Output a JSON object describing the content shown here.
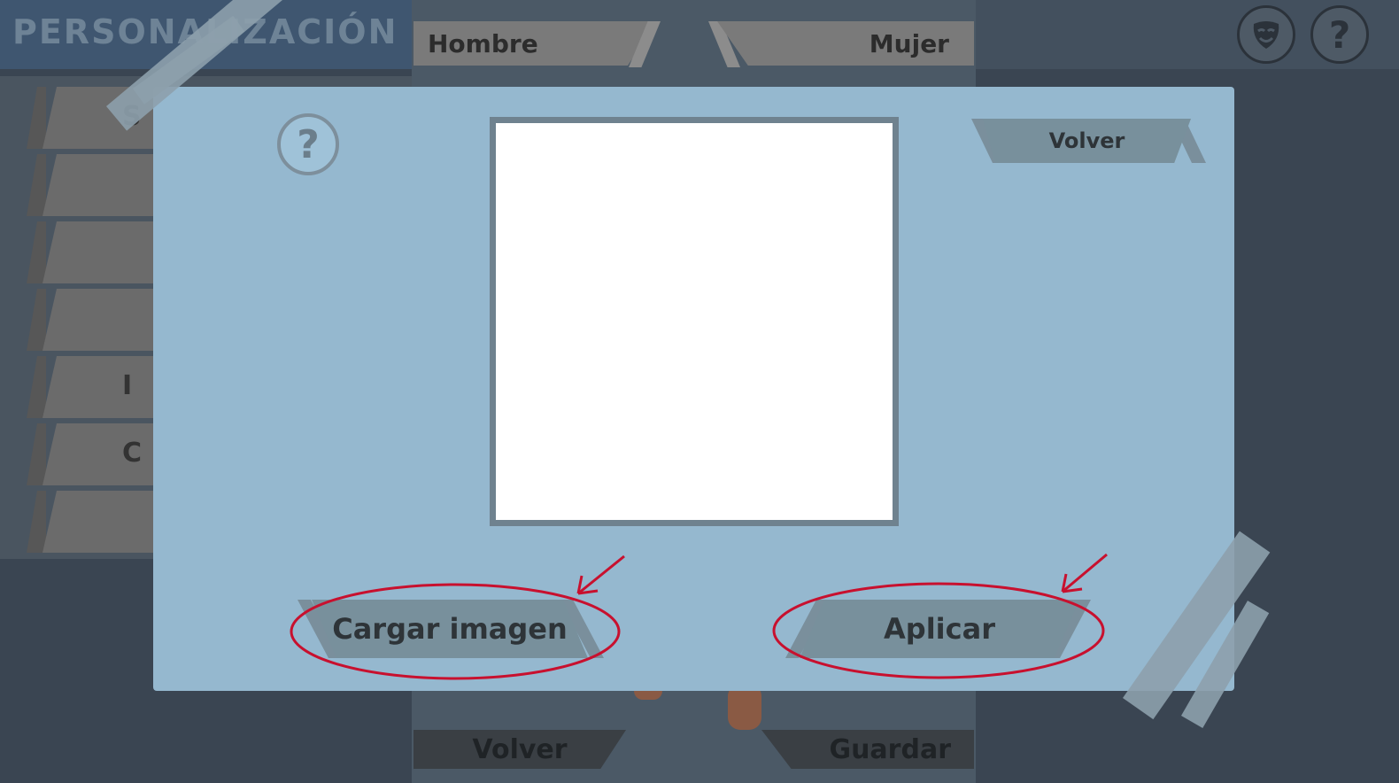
{
  "header": {
    "title": "PERSONALIZACIÓN",
    "tabs": [
      {
        "label": "Hombre"
      },
      {
        "label": "Mujer"
      }
    ],
    "icons": [
      "mask-icon",
      "help-icon"
    ]
  },
  "side_menu": {
    "visible_letters": [
      "S",
      "",
      "",
      "",
      "I",
      "C",
      ""
    ]
  },
  "footer": {
    "back_label": "Volver",
    "save_label": "Guardar"
  },
  "modal": {
    "help_glyph": "?",
    "back_label": "Volver",
    "load_image_label": "Cargar imagen",
    "apply_label": "Aplicar"
  },
  "colors": {
    "modal_bg": "#95b8cf",
    "button_bg": "#78909c",
    "annotation_red": "#c8102e"
  }
}
